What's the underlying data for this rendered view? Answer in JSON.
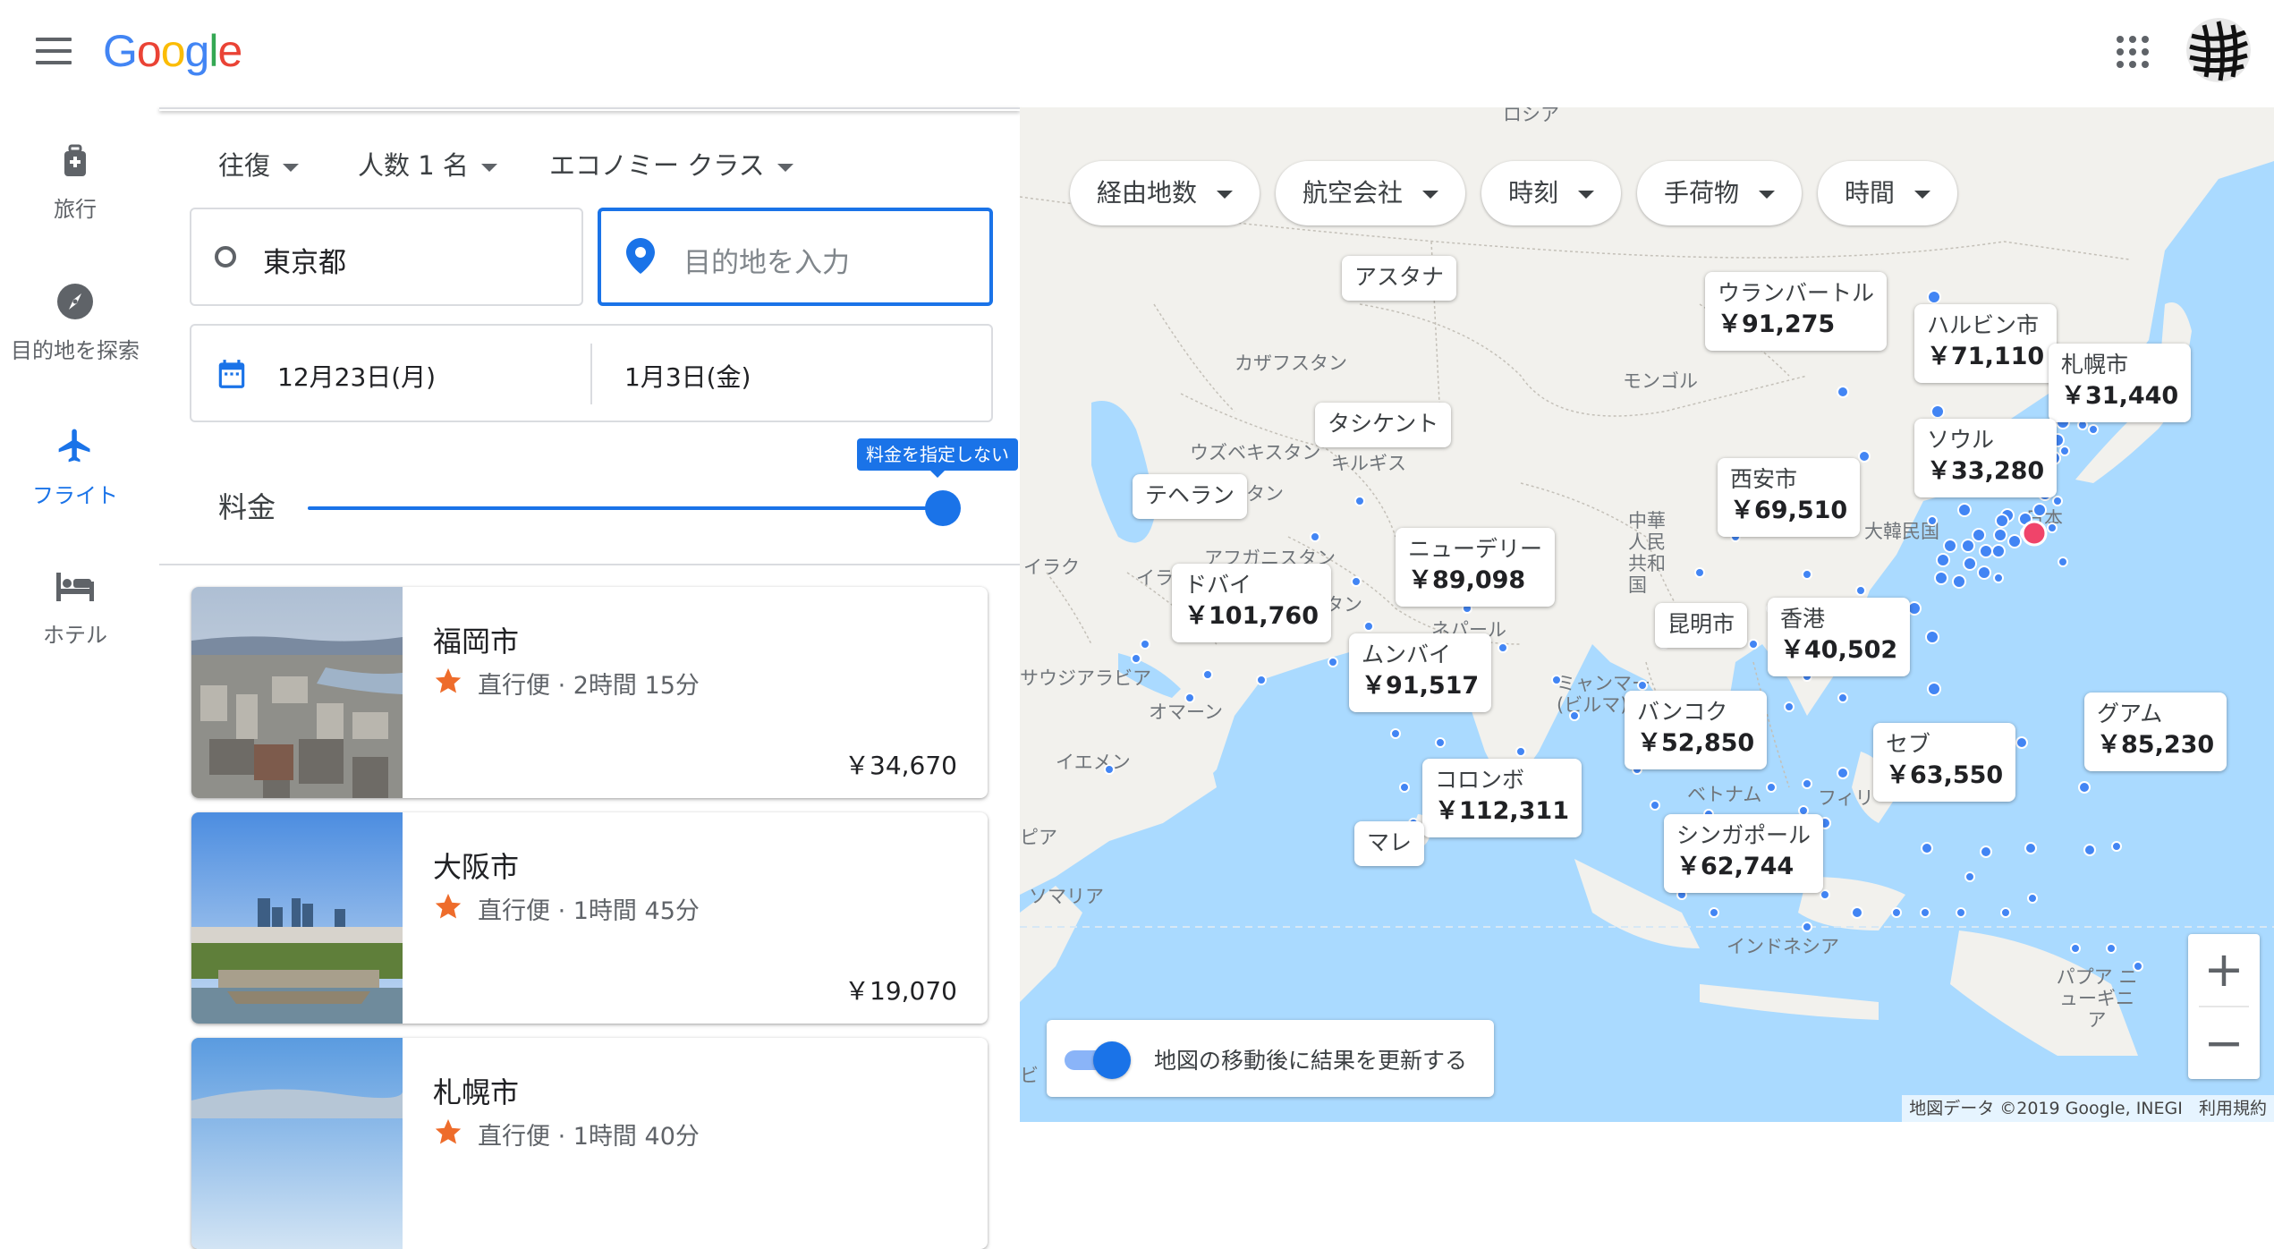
{
  "header": {
    "logo_letters": [
      "G",
      "o",
      "o",
      "g",
      "l",
      "e"
    ],
    "logo_colors": [
      "#4285f4",
      "#ea4335",
      "#fbbc05",
      "#4285f4",
      "#34a853",
      "#ea4335"
    ]
  },
  "nav": {
    "items": [
      {
        "label": "旅行",
        "icon": "luggage-icon"
      },
      {
        "label": "目的地を探索",
        "icon": "compass-icon"
      },
      {
        "label": "フライト",
        "icon": "airplane-icon",
        "active": true
      },
      {
        "label": "ホテル",
        "icon": "bed-icon"
      }
    ]
  },
  "search": {
    "trip_type": "往復",
    "passengers": "人数 1 名",
    "cabin_class": "エコノミー クラス",
    "origin": "東京都",
    "destination_placeholder": "目的地を入力",
    "depart_date": "12月23日(月)",
    "return_date": "1月3日(金)",
    "price_label": "料金",
    "price_tooltip": "料金を指定しない",
    "price_slider_fraction": 1.0
  },
  "results": [
    {
      "city": "福岡市",
      "stops": "直行便",
      "duration": "2時間 15分",
      "price": "￥34,670"
    },
    {
      "city": "大阪市",
      "stops": "直行便",
      "duration": "1時間 45分",
      "price": "￥19,070"
    },
    {
      "city": "札幌市",
      "stops": "直行便",
      "duration": "1時間 40分",
      "price": ""
    }
  ],
  "map": {
    "filters": [
      "経由地数",
      "航空会社",
      "時刻",
      "手荷物",
      "時間"
    ],
    "callouts": [
      {
        "name": "アスタナ",
        "price": ""
      },
      {
        "name": "ウランバートル",
        "price": "￥91,275"
      },
      {
        "name": "ハルビン市",
        "price": "￥71,110"
      },
      {
        "name": "札幌市",
        "price": "￥31,440"
      },
      {
        "name": "タシケント",
        "price": ""
      },
      {
        "name": "ソウル",
        "price": "￥33,280"
      },
      {
        "name": "テヘラン",
        "price": ""
      },
      {
        "name": "西安市",
        "price": "￥69,510"
      },
      {
        "name": "ニューデリー",
        "price": "￥89,098"
      },
      {
        "name": "ドバイ",
        "price": "￥101,760"
      },
      {
        "name": "昆明市",
        "price": ""
      },
      {
        "name": "香港",
        "price": "￥40,502"
      },
      {
        "name": "ムンバイ",
        "price": "￥91,517"
      },
      {
        "name": "バンコク",
        "price": "￥52,850"
      },
      {
        "name": "グアム",
        "price": "￥85,230"
      },
      {
        "name": "セブ",
        "price": "￥63,550"
      },
      {
        "name": "コロンボ",
        "price": "￥112,311"
      },
      {
        "name": "マレ",
        "price": ""
      },
      {
        "name": "シンガポール",
        "price": "￥62,744"
      }
    ],
    "region_labels": [
      "ロシア",
      "カザフスタン",
      "モンゴル",
      "ウズベキスタン",
      "キルギス",
      "スタン",
      "中華人民共和国",
      "大韓民国",
      "日本",
      "アフガニスタン",
      "スタン",
      "ネパール",
      "イラク",
      "イラ",
      "サウジアラビア",
      "オマーン",
      "イエメン",
      "ミャンマー (ビルマ)",
      "タ",
      "ベトナム",
      "フィリ",
      "マ",
      "インドネシア",
      "パプア ニューギニア",
      "ピア",
      "ソマリア",
      "ビ"
    ],
    "update_on_move_label": "地図の移動後に結果を更新する",
    "update_on_move": true,
    "attribution": "地図データ ©2019 Google, INEGI",
    "terms": "利用規約",
    "zoom_in": "+",
    "zoom_out": "−",
    "colors": {
      "water": "#aadaff",
      "land": "#f2f1ed",
      "pin": "#4285f4",
      "origin_pin": "#f0446a"
    }
  }
}
